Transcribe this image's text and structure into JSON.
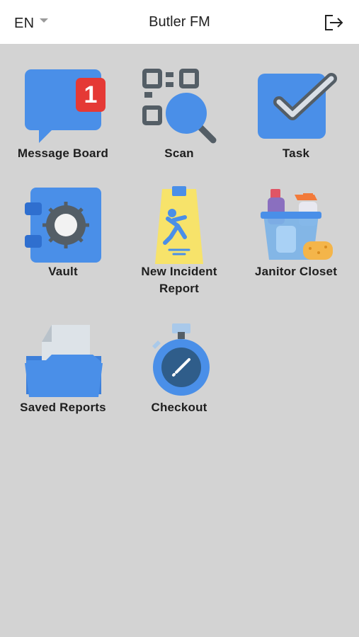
{
  "header": {
    "language": "EN",
    "title": "Butler FM"
  },
  "icons": {
    "language_dropdown": "chevron-down-icon",
    "logout": "logout-icon"
  },
  "tiles": [
    {
      "label": "Message Board",
      "icon": "chat-bubble-icon",
      "badge": "1"
    },
    {
      "label": "Scan",
      "icon": "qr-search-icon"
    },
    {
      "label": "Task",
      "icon": "checkbox-icon"
    },
    {
      "label": "Vault",
      "icon": "safe-icon"
    },
    {
      "label": "New Incident\nReport",
      "icon": "wet-floor-sign-icon"
    },
    {
      "label": "Janitor Closet",
      "icon": "cleaning-bucket-icon"
    },
    {
      "label": "Saved Reports",
      "icon": "folder-icon"
    },
    {
      "label": "Checkout",
      "icon": "stopwatch-icon"
    }
  ],
  "colors": {
    "background": "#d3d3d3",
    "header_bg": "#ffffff",
    "primary_blue": "#4a8fe8",
    "badge_red": "#e53935",
    "dark_gray": "#545e66",
    "yellow": "#f7e36a"
  }
}
